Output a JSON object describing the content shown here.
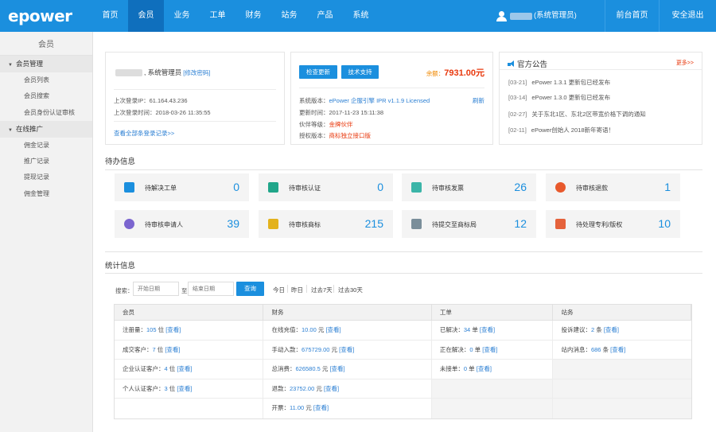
{
  "app": {
    "logo": "epower"
  },
  "nav": [
    "首页",
    "会员",
    "业务",
    "工单",
    "财务",
    "站务",
    "产品",
    "系统"
  ],
  "user": {
    "role": "(系统管理员)"
  },
  "top_buttons": {
    "front": "前台首页",
    "logout": "安全退出"
  },
  "sidebar": {
    "title": "会员",
    "groups": [
      {
        "label": "会员管理",
        "items": [
          "会员列表",
          "会员搜索",
          "会员身份认证审核"
        ]
      },
      {
        "label": "在线推广",
        "items": [
          "佣金记录",
          "推广记录",
          "提现记录",
          "佣金管理"
        ]
      }
    ]
  },
  "profile": {
    "greeting": ", 系统管理员",
    "edit_pwd": "[修改密码]",
    "last_ip": "上次登录IP：61.164.43.236",
    "last_time": "上次登录时间：2018-03-26 11:35:55",
    "log_link": "查看全部条登录记录>>"
  },
  "system": {
    "check_update": "检查更新",
    "tech_support": "技术支持",
    "balance_label": "余额：",
    "balance_value": "7931.00元",
    "version_label": "系统版本：",
    "version_value": "ePower 企服引擎 IPR v1.1.9 Licensed",
    "refresh": "刷新",
    "updated": "更新时间：2017-11-23 15:11:38",
    "partner_label": "伙伴等级：",
    "partner_value": "金牌伙伴",
    "license_label": "授权版本：",
    "license_value": "商标独立接口版"
  },
  "announcements": {
    "title": "官方公告",
    "more": "更多>>",
    "items": [
      {
        "date": "[03-21]",
        "text": "ePower 1.3.1 更新包已经发布"
      },
      {
        "date": "[03-14]",
        "text": "ePower 1.3.0 更新包已经发布"
      },
      {
        "date": "[02-27]",
        "text": "关于东北1区、东北2区带宽价格下调的通知"
      },
      {
        "date": "[02-11]",
        "text": "ePower创始人 2018新年寄语！"
      }
    ]
  },
  "todo": {
    "title": "待办信息",
    "tiles": [
      {
        "label": "待解决工单",
        "count": "0"
      },
      {
        "label": "待审核认证",
        "count": "0"
      },
      {
        "label": "待审核发票",
        "count": "26"
      },
      {
        "label": "待审核退款",
        "count": "1"
      },
      {
        "label": "待审核申请人",
        "count": "39"
      },
      {
        "label": "待审核商标",
        "count": "215"
      },
      {
        "label": "待提交至商标局",
        "count": "12"
      },
      {
        "label": "待处理专利/版权",
        "count": "10"
      }
    ]
  },
  "stats": {
    "title": "统计信息",
    "search_label": "搜索：",
    "start_placeholder": "开始日期",
    "to_label": "至",
    "end_placeholder": "结束日期",
    "query": "查询",
    "quick": [
      "今日",
      "昨日",
      "过去7天",
      "过去30天"
    ],
    "headers": [
      "会员",
      "财务",
      "工单",
      "站务"
    ],
    "view": "[查看]",
    "rows": [
      [
        {
          "label": "注册量：",
          "value": "105",
          "unit": " 位 "
        },
        {
          "label": "在线充值：",
          "value": "10.00",
          "unit": " 元 "
        },
        {
          "label": "已解决：",
          "value": "34",
          "unit": " 单 "
        },
        {
          "label": "投诉建议：",
          "value": "2",
          "unit": " 条 "
        }
      ],
      [
        {
          "label": "成交客户：",
          "value": "7",
          "unit": " 位 "
        },
        {
          "label": "手动入款：",
          "value": "675729.00",
          "unit": " 元 "
        },
        {
          "label": "正在解决：",
          "value": "0",
          "unit": " 单 "
        },
        {
          "label": "站内消息：",
          "value": "686",
          "unit": " 条 "
        }
      ],
      [
        {
          "label": "企业认证客户：",
          "value": "4",
          "unit": " 位 "
        },
        {
          "label": "总消费：",
          "value": "626580.5",
          "unit": " 元 "
        },
        {
          "label": "未接单：",
          "value": "0",
          "unit": " 单 "
        },
        null
      ],
      [
        {
          "label": "个人认证客户：",
          "value": "3",
          "unit": " 位 "
        },
        {
          "label": "退款：",
          "value": "23752.00",
          "unit": " 元 "
        },
        null,
        null
      ],
      [
        null,
        {
          "label": "开票：",
          "value": "11.00",
          "unit": " 元 "
        },
        null,
        null
      ]
    ]
  }
}
